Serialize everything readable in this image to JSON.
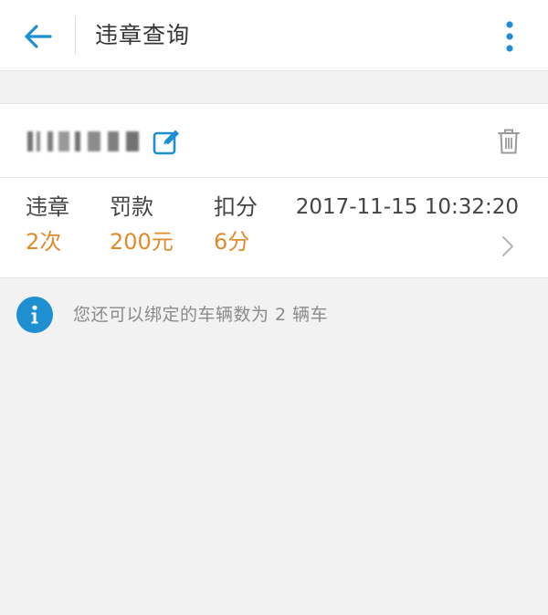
{
  "header": {
    "title": "违章查询",
    "back_icon": "arrow-left-icon",
    "more_icon": "more-vertical-icon"
  },
  "vehicle": {
    "plate_number": "██████",
    "edit_icon": "edit-icon",
    "delete_icon": "trash-icon"
  },
  "summary": {
    "violations_label": "违章",
    "violations_value": "2次",
    "fine_label": "罚款",
    "fine_value": "200元",
    "points_label": "扣分",
    "points_value": "6分",
    "timestamp": "2017-11-15 10:32:20",
    "chevron_icon": "chevron-right-icon"
  },
  "notice": {
    "icon": "info-icon",
    "text": "您还可以绑定的车辆数为 2 辆车"
  },
  "colors": {
    "accent": "#1e8fd0",
    "value_orange": "#e08a2c",
    "background": "#f2f2f2"
  }
}
